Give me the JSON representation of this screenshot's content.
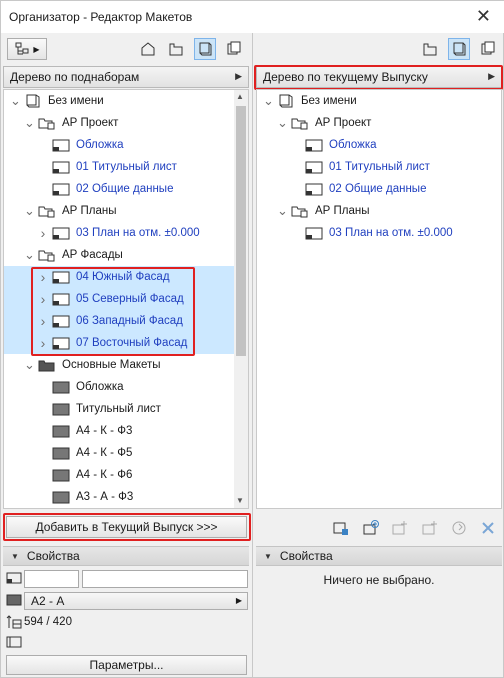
{
  "window": {
    "title": "Организатор - Редактор Макетов",
    "close_glyph": "✕"
  },
  "left_panel": {
    "header": "Дерево по поднаборам",
    "tree": [
      {
        "label": "Без имени",
        "level": 0,
        "chev": "down",
        "icon": "book",
        "color": "black"
      },
      {
        "label": "АР Проект",
        "level": 1,
        "chev": "down",
        "icon": "folder-open",
        "color": "black"
      },
      {
        "label": "Обложка",
        "level": 2,
        "chev": "",
        "icon": "layout",
        "color": "blue"
      },
      {
        "label": "01 Титульный лист",
        "level": 2,
        "chev": "",
        "icon": "layout",
        "color": "blue"
      },
      {
        "label": "02 Общие данные",
        "level": 2,
        "chev": "",
        "icon": "layout",
        "color": "blue"
      },
      {
        "label": "АР Планы",
        "level": 1,
        "chev": "down",
        "icon": "folder-open",
        "color": "black"
      },
      {
        "label": "03 План на отм. ±0.000",
        "level": 2,
        "chev": "right",
        "icon": "layout",
        "color": "blue"
      },
      {
        "label": "АР Фасады",
        "level": 1,
        "chev": "down",
        "icon": "folder-open",
        "color": "black"
      },
      {
        "label": "04 Южный Фасад",
        "level": 2,
        "chev": "right",
        "icon": "layout",
        "color": "blue",
        "selected": true
      },
      {
        "label": "05 Северный Фасад",
        "level": 2,
        "chev": "right",
        "icon": "layout",
        "color": "blue",
        "selected": true
      },
      {
        "label": "06 Западный Фасад",
        "level": 2,
        "chev": "right",
        "icon": "layout",
        "color": "blue",
        "selected": true
      },
      {
        "label": "07 Восточный Фасад",
        "level": 2,
        "chev": "right",
        "icon": "layout",
        "color": "blue",
        "selected": true
      },
      {
        "label": "Основные Макеты",
        "level": 1,
        "chev": "down",
        "icon": "folder-dark",
        "color": "black"
      },
      {
        "label": "Обложка",
        "level": 2,
        "chev": "",
        "icon": "master",
        "color": "black"
      },
      {
        "label": "Титульный лист",
        "level": 2,
        "chev": "",
        "icon": "master",
        "color": "black"
      },
      {
        "label": "А4 - К - Ф3",
        "level": 2,
        "chev": "",
        "icon": "master",
        "color": "black"
      },
      {
        "label": "А4 - К - Ф5",
        "level": 2,
        "chev": "",
        "icon": "master",
        "color": "black"
      },
      {
        "label": "А4 - К - Ф6",
        "level": 2,
        "chev": "",
        "icon": "master",
        "color": "black"
      },
      {
        "label": "А3 - А - Ф3",
        "level": 2,
        "chev": "",
        "icon": "master",
        "color": "black"
      }
    ],
    "add_button": "Добавить в Текущий Выпуск >>>",
    "properties": {
      "title": "Свойства",
      "master_value": "А2 - А",
      "size_value": "594 / 420",
      "params_button": "Параметры..."
    }
  },
  "right_panel": {
    "header": "Дерево по текущему Выпуску",
    "tree": [
      {
        "label": "Без имени",
        "level": 0,
        "chev": "down",
        "icon": "book",
        "color": "black"
      },
      {
        "label": "АР Проект",
        "level": 1,
        "chev": "down",
        "icon": "folder-open",
        "color": "black"
      },
      {
        "label": "Обложка",
        "level": 2,
        "chev": "",
        "icon": "layout",
        "color": "blue"
      },
      {
        "label": "01 Титульный лист",
        "level": 2,
        "chev": "",
        "icon": "layout",
        "color": "blue"
      },
      {
        "label": "02 Общие данные",
        "level": 2,
        "chev": "",
        "icon": "layout",
        "color": "blue"
      },
      {
        "label": "АР Планы",
        "level": 1,
        "chev": "down",
        "icon": "folder-open",
        "color": "black"
      },
      {
        "label": "03 План на отм. ±0.000",
        "level": 2,
        "chev": "",
        "icon": "layout",
        "color": "blue"
      }
    ],
    "properties": {
      "title": "Свойства",
      "empty_text": "Ничего не выбрано."
    }
  },
  "colors": {
    "accent_selection": "#cce8ff",
    "highlight_red": "#e02020",
    "link_blue": "#1f3fbf"
  }
}
